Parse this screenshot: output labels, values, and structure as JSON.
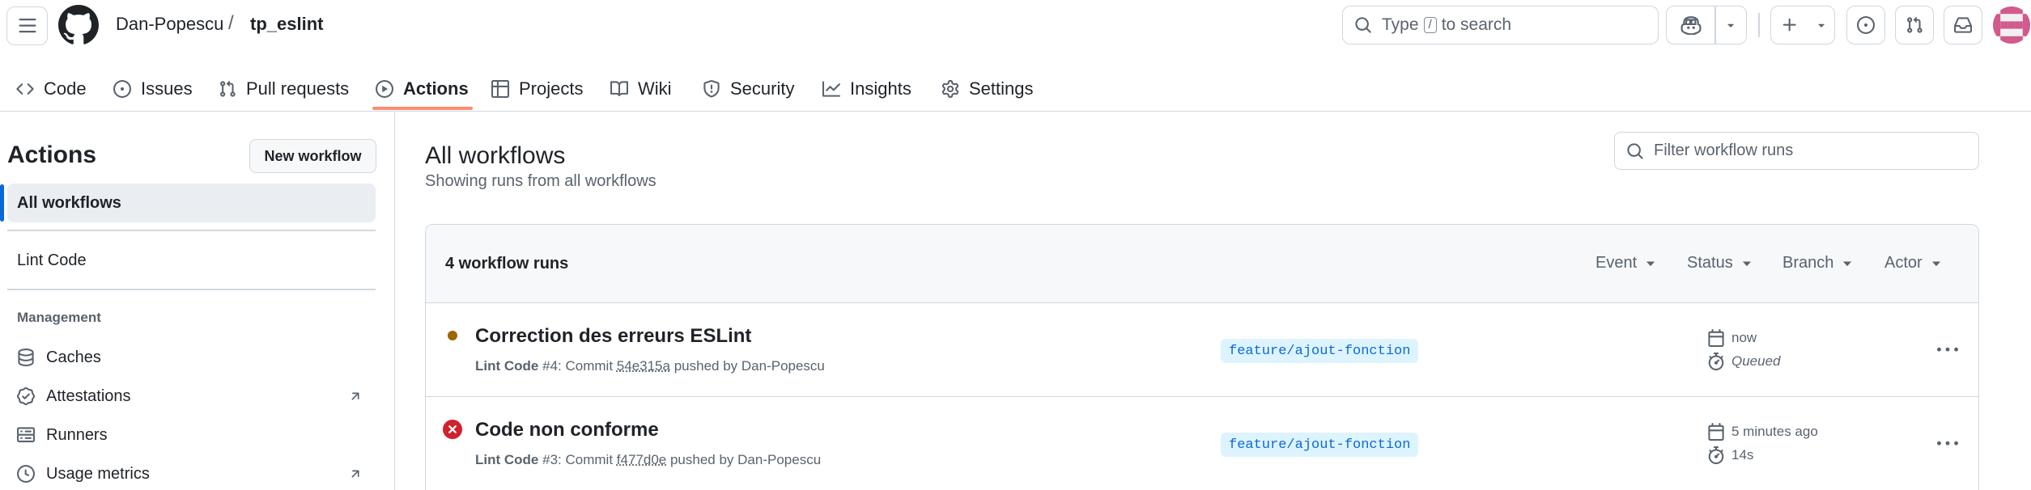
{
  "header": {
    "owner": "Dan-Popescu",
    "separator": "/",
    "repo": "tp_eslint",
    "search": {
      "prefix": "Type",
      "key": "/",
      "suffix": "to search"
    }
  },
  "repo_nav": {
    "tabs": [
      {
        "label": "Code",
        "icon": "code-icon"
      },
      {
        "label": "Issues",
        "icon": "issue-opened-icon"
      },
      {
        "label": "Pull requests",
        "icon": "git-pull-request-icon"
      },
      {
        "label": "Actions",
        "icon": "play-icon",
        "selected": true
      },
      {
        "label": "Projects",
        "icon": "table-icon"
      },
      {
        "label": "Wiki",
        "icon": "book-icon"
      },
      {
        "label": "Security",
        "icon": "shield-icon"
      },
      {
        "label": "Insights",
        "icon": "graph-icon"
      },
      {
        "label": "Settings",
        "icon": "gear-icon"
      }
    ]
  },
  "sidebar": {
    "title": "Actions",
    "new_workflow_label": "New workflow",
    "all_workflows_label": "All workflows",
    "workflows": [
      "Lint Code"
    ],
    "management_heading": "Management",
    "management_items": [
      {
        "label": "Caches",
        "icon": "database-icon"
      },
      {
        "label": "Attestations",
        "icon": "verified-icon",
        "external": true
      },
      {
        "label": "Runners",
        "icon": "server-icon"
      },
      {
        "label": "Usage metrics",
        "icon": "clock-icon",
        "external": true
      }
    ]
  },
  "main": {
    "title": "All workflows",
    "subtitle": "Showing runs from all workflows",
    "filter_placeholder": "Filter workflow runs",
    "runs_count": "4 workflow runs",
    "filters": [
      "Event",
      "Status",
      "Branch",
      "Actor"
    ],
    "runs": [
      {
        "title": "Correction des erreurs ESLint",
        "workflow": "Lint Code",
        "run_number": "#4",
        "commit_prefix": ": Commit",
        "sha": "54e315a",
        "pushed_by": "pushed by Dan-Popescu",
        "branch": "feature/ajout-fonction",
        "time": "now",
        "duration": "Queued",
        "status": "queued"
      },
      {
        "title": "Code non conforme",
        "workflow": "Lint Code",
        "run_number": "#3",
        "commit_prefix": ": Commit",
        "sha": "f477d0e",
        "pushed_by": "pushed by Dan-Popescu",
        "branch": "feature/ajout-fonction",
        "time": "5 minutes ago",
        "duration": "14s",
        "status": "failure"
      }
    ]
  },
  "colors": {
    "accent": "#0969da",
    "tab_underline": "#fd8c73",
    "queued": "#9a6700",
    "failure": "#cf222e",
    "branch_bg": "#ddf4ff"
  }
}
